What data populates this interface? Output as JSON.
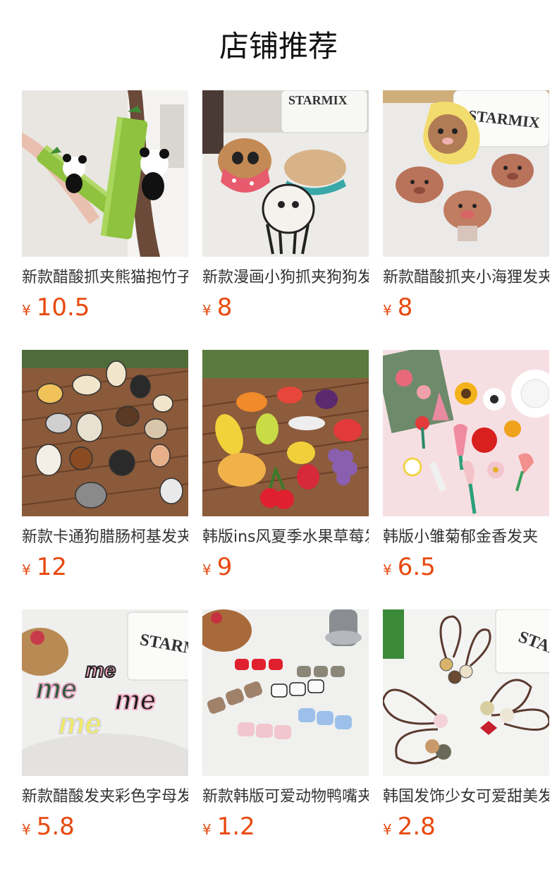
{
  "page": {
    "title": "店铺推荐"
  },
  "products": [
    {
      "title": "新款醋酸抓夹熊猫抱竹子发夹",
      "currency": "¥",
      "price": "10.5",
      "image": "panda-bamboo-claw-clip-photo"
    },
    {
      "title": "新款漫画小狗抓夹狗狗发夹",
      "currency": "¥",
      "price": "8",
      "image": "cartoon-dog-claw-clip-photo"
    },
    {
      "title": "新款醋酸抓夹小海狸发夹",
      "currency": "¥",
      "price": "8",
      "image": "beaver-claw-clip-photo"
    },
    {
      "title": "新款卡通狗腊肠柯基发夹",
      "currency": "¥",
      "price": "12",
      "image": "cartoon-dog-hair-clips-photo"
    },
    {
      "title": "韩版ins风夏季水果草莓发夹",
      "currency": "¥",
      "price": "9",
      "image": "fruit-hair-clips-photo"
    },
    {
      "title": "韩版小雏菊郁金香发夹",
      "currency": "¥",
      "price": "6.5",
      "image": "daisy-tulip-hair-clips-photo"
    },
    {
      "title": "新款醋酸发夹彩色字母发夹",
      "currency": "¥",
      "price": "5.8",
      "image": "letter-hair-clips-photo"
    },
    {
      "title": "新款韩版可爱动物鸭嘴夹",
      "currency": "¥",
      "price": "1.2",
      "image": "cat-hair-clips-photo"
    },
    {
      "title": "韩国发饰少女可爱甜美发绳",
      "currency": "¥",
      "price": "2.8",
      "image": "hair-ties-photo"
    }
  ],
  "photo_text": {
    "brand": "STARMIX",
    "me": "me"
  }
}
